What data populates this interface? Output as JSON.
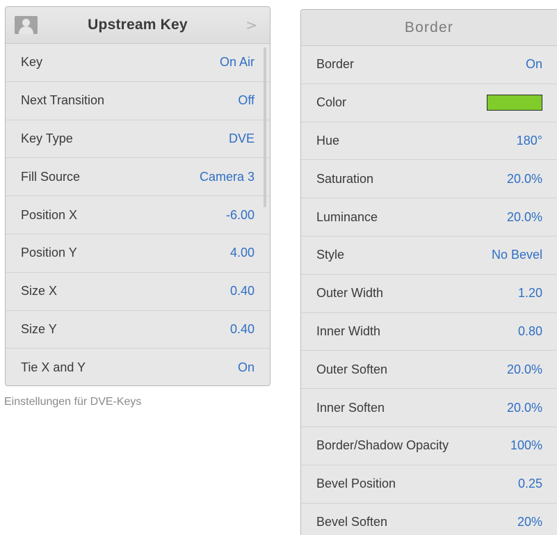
{
  "upstream_key": {
    "title": "Upstream Key",
    "chevron": ">",
    "rows": [
      {
        "label": "Key",
        "value": "On Air"
      },
      {
        "label": "Next Transition",
        "value": "Off"
      },
      {
        "label": "Key Type",
        "value": "DVE"
      },
      {
        "label": "Fill Source",
        "value": "Camera 3"
      },
      {
        "label": "Position X",
        "value": "-6.00"
      },
      {
        "label": "Position Y",
        "value": "4.00"
      },
      {
        "label": "Size X",
        "value": "0.40"
      },
      {
        "label": "Size Y",
        "value": "0.40"
      },
      {
        "label": "Tie X and Y",
        "value": "On"
      }
    ]
  },
  "caption": "Einstellungen für DVE-Keys",
  "border": {
    "title": "Border",
    "color_swatch": "#7fcc2b",
    "rows": [
      {
        "label": "Border",
        "value": "On"
      },
      {
        "label": "Color",
        "value": ""
      },
      {
        "label": "Hue",
        "value": "180°"
      },
      {
        "label": "Saturation",
        "value": "20.0%"
      },
      {
        "label": "Luminance",
        "value": "20.0%"
      },
      {
        "label": "Style",
        "value": "No Bevel"
      },
      {
        "label": "Outer Width",
        "value": "1.20"
      },
      {
        "label": "Inner Width",
        "value": "0.80"
      },
      {
        "label": "Outer Soften",
        "value": "20.0%"
      },
      {
        "label": "Inner Soften",
        "value": "20.0%"
      },
      {
        "label": "Border/Shadow Opacity",
        "value": "100%"
      },
      {
        "label": "Bevel Position",
        "value": "0.25"
      },
      {
        "label": "Bevel Soften",
        "value": "20%"
      }
    ]
  },
  "colors": {
    "value_blue": "#2f6fc4",
    "label_text": "#3a3a3a",
    "panel_bg": "#e7e7e7"
  }
}
